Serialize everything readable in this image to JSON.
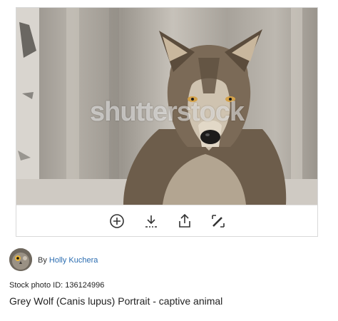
{
  "image": {
    "watermark": "shutterstock",
    "subject_icon": "wolf-photo"
  },
  "toolbar": {
    "buttons": [
      {
        "icon": "plus-circle-icon"
      },
      {
        "icon": "download-icon"
      },
      {
        "icon": "share-icon"
      },
      {
        "icon": "edit-icon"
      }
    ]
  },
  "author": {
    "prefix": "By",
    "name": "Holly Kuchera",
    "link_color": "#2a6cb0"
  },
  "stock": {
    "id_label": "Stock photo ID: 136124996"
  },
  "title": "Grey Wolf (Canis lupus) Portrait - captive animal"
}
